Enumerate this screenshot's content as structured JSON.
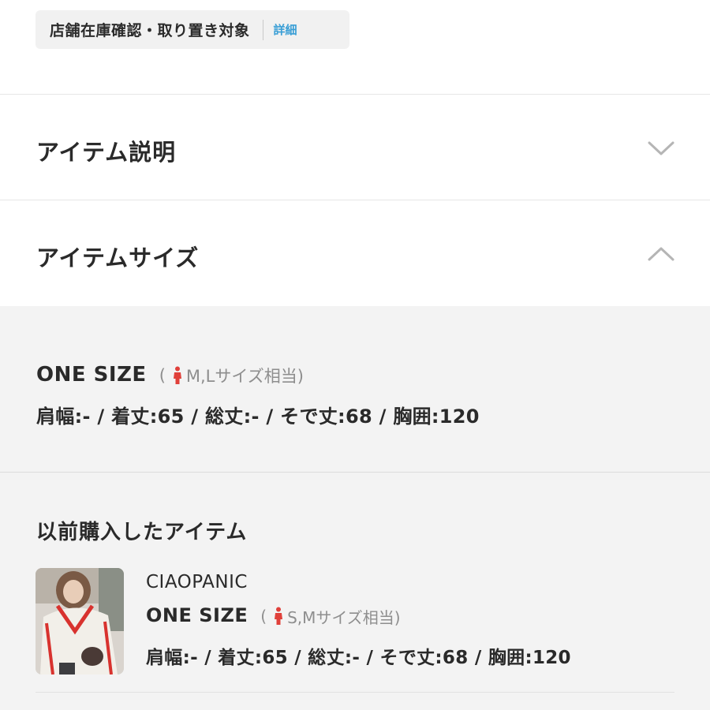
{
  "store": {
    "label": "店舗在庫確認・取り置き対象",
    "detail_link": "詳細"
  },
  "sections": [
    {
      "title": "アイテム説明",
      "chevron": "chevron-down-icon",
      "expanded": false
    },
    {
      "title": "アイテムサイズ",
      "chevron": "chevron-up-icon",
      "expanded": true
    }
  ],
  "item_size": {
    "size_name": "ONE SIZE",
    "equiv_open": "(",
    "equiv_text": "M,Lサイズ相当)",
    "measurements": "肩幅:- / 着丈:65 / 総丈:- / そで丈:68 / 胸囲:120"
  },
  "previous": {
    "heading": "以前購入したアイテム",
    "brand": "CIAOPANIC",
    "size_name": "ONE SIZE",
    "equiv_open": "(",
    "equiv_text": "S,Mサイズ相当)",
    "measurements": "肩幅:- / 着丈:65 / 総丈:- / そで丈:68 / 胸囲:120"
  },
  "colors": {
    "accent_link": "#3a9fd6",
    "person_icon": "#e0403a",
    "panel_bg": "#f3f3f3"
  },
  "icons": {
    "person": "person-icon",
    "thumbnail": "product-thumbnail"
  }
}
